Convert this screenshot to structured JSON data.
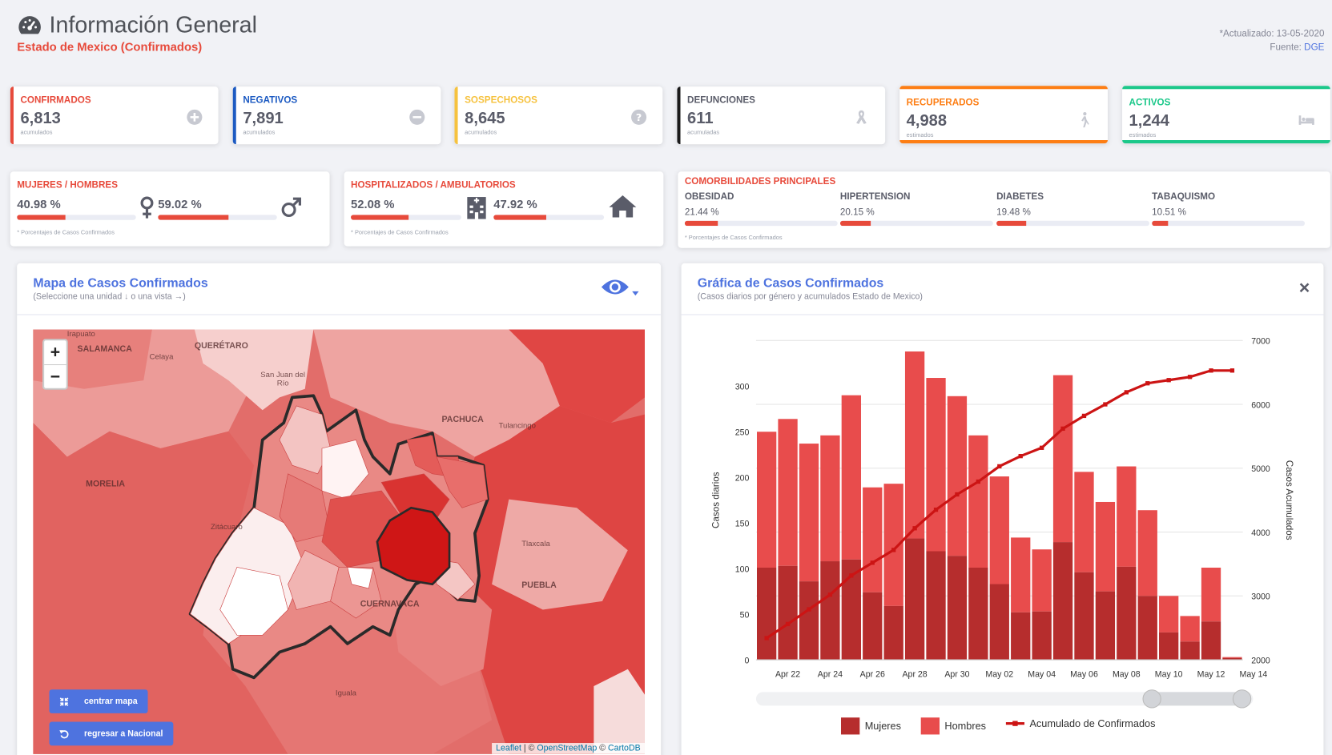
{
  "header": {
    "title": "Información General",
    "subtitle": "Estado de Mexico (Confirmados)",
    "updated": "*Actualizado: 13-05-2020",
    "source_label": "Fuente:",
    "source_link": "DGE"
  },
  "stats": [
    {
      "label": "CONFIRMADOS",
      "value": "6,813",
      "sub": "acumulados",
      "color": "#e74a3b",
      "icon": "plus-circle-icon"
    },
    {
      "label": "NEGATIVOS",
      "value": "7,891",
      "sub": "acumulados",
      "color": "#1c5ac2",
      "icon": "minus-circle-icon"
    },
    {
      "label": "SOSPECHOSOS",
      "value": "8,645",
      "sub": "acumulados",
      "color": "#f6c23e",
      "icon": "question-circle-icon"
    },
    {
      "label": "DEFUNCIONES",
      "value": "611",
      "sub": "acumuladas",
      "color": "#1a1a1a",
      "icon": "ribbon-icon"
    },
    {
      "label": "RECUPERADOS",
      "value": "4,988",
      "sub": "estimados",
      "color": "#fd7e14",
      "icon": "walking-icon"
    },
    {
      "label": "ACTIVOS",
      "value": "1,244",
      "sub": "estimados",
      "color": "#1cc88a",
      "icon": "bed-icon"
    }
  ],
  "gender": {
    "label": "MUJERES / HOMBRES",
    "women_pct": "40.98 %",
    "women_fraction": 0.4098,
    "men_pct": "59.02 %",
    "men_fraction": 0.5902,
    "foot": "* Porcentajes de Casos Confirmados"
  },
  "hospital": {
    "label": "HOSPITALIZADOS / AMBULATORIOS",
    "hosp_pct": "52.08 %",
    "hosp_fraction": 0.5208,
    "amb_pct": "47.92 %",
    "amb_fraction": 0.4792,
    "foot": "* Porcentajes de Casos Confirmados"
  },
  "comorbidities": {
    "label": "COMORBILIDADES PRINCIPALES",
    "items": [
      {
        "name": "OBESIDAD",
        "pct": "21.44 %",
        "fraction": 0.2144
      },
      {
        "name": "HIPERTENSION",
        "pct": "20.15 %",
        "fraction": 0.2015
      },
      {
        "name": "DIABETES",
        "pct": "19.48 %",
        "fraction": 0.1948
      },
      {
        "name": "TABAQUISMO",
        "pct": "10.51 %",
        "fraction": 0.1051
      }
    ],
    "foot": "* Porcentajes de Casos Confirmados"
  },
  "map_panel": {
    "title": "Mapa de Casos Confirmados",
    "subtitle": "(Seleccione una unidad ↓ o una vista →)",
    "zoom_in": "+",
    "zoom_out": "−",
    "places": [
      "Irapuato",
      "SALAMANCA",
      "Celaya",
      "QUERÉTARO",
      "San Juan del Río",
      "PACHUCA",
      "Tulancingo",
      "MORELIA",
      "Zitácuaro",
      "Tlaxcala",
      "PUEBLA",
      "CUERNAVACA",
      "Iguala"
    ],
    "btn_center": "centrar mapa",
    "btn_back": "regresar a Nacional",
    "attribution_leaflet": "Leaflet",
    "attribution_sep": " | © ",
    "attribution_osm": "OpenStreetMap",
    "attribution_sep2": " © ",
    "attribution_carto": "CartoDB"
  },
  "chart_panel": {
    "title": "Gráfica de Casos Confirmados",
    "subtitle": "(Casos diarios por género y acumulados Estado de Mexico)",
    "close": "×"
  },
  "chart_data": {
    "type": "bar",
    "ylabel": "Casos diarios",
    "y2label": "Casos Acumulados",
    "ylim": [
      0,
      350
    ],
    "y2lim": [
      2000,
      7000
    ],
    "yticks": [
      0,
      50,
      100,
      150,
      200,
      250,
      300
    ],
    "y2ticks": [
      2000,
      3000,
      4000,
      5000,
      6000,
      7000
    ],
    "x_tick_labels": [
      "Apr 22",
      "Apr 24",
      "Apr 26",
      "Apr 28",
      "Apr 30",
      "May 02",
      "May 04",
      "May 06",
      "May 08",
      "May 10",
      "May 12",
      "May 14"
    ],
    "categories": [
      "Apr 21",
      "Apr 22",
      "Apr 23",
      "Apr 24",
      "Apr 25",
      "Apr 26",
      "Apr 27",
      "Apr 28",
      "Apr 29",
      "Apr 30",
      "May 01",
      "May 02",
      "May 03",
      "May 04",
      "May 05",
      "May 06",
      "May 07",
      "May 08",
      "May 09",
      "May 10",
      "May 11",
      "May 12",
      "May 13"
    ],
    "series": [
      {
        "name": "Mujeres",
        "type": "bar",
        "color": "#b62d2d",
        "values": [
          101,
          103,
          86,
          108,
          110,
          74,
          59,
          133,
          119,
          114,
          101,
          83,
          52,
          53,
          129,
          96,
          75,
          102,
          70,
          30,
          20,
          42,
          2
        ]
      },
      {
        "name": "Hombres",
        "type": "bar",
        "color": "#e84c4c",
        "values": [
          149,
          161,
          151,
          138,
          180,
          115,
          134,
          205,
          190,
          175,
          145,
          118,
          82,
          68,
          183,
          110,
          98,
          110,
          94,
          40,
          28,
          59,
          1
        ]
      },
      {
        "name": "Acumulado de Confirmados",
        "type": "line",
        "color": "#cc1414",
        "values": [
          2340,
          2560,
          2790,
          3020,
          3320,
          3520,
          3720,
          4060,
          4350,
          4590,
          4790,
          5030,
          5190,
          5320,
          5620,
          5820,
          6000,
          6190,
          6330,
          6380,
          6430,
          6530,
          6530
        ]
      }
    ]
  }
}
